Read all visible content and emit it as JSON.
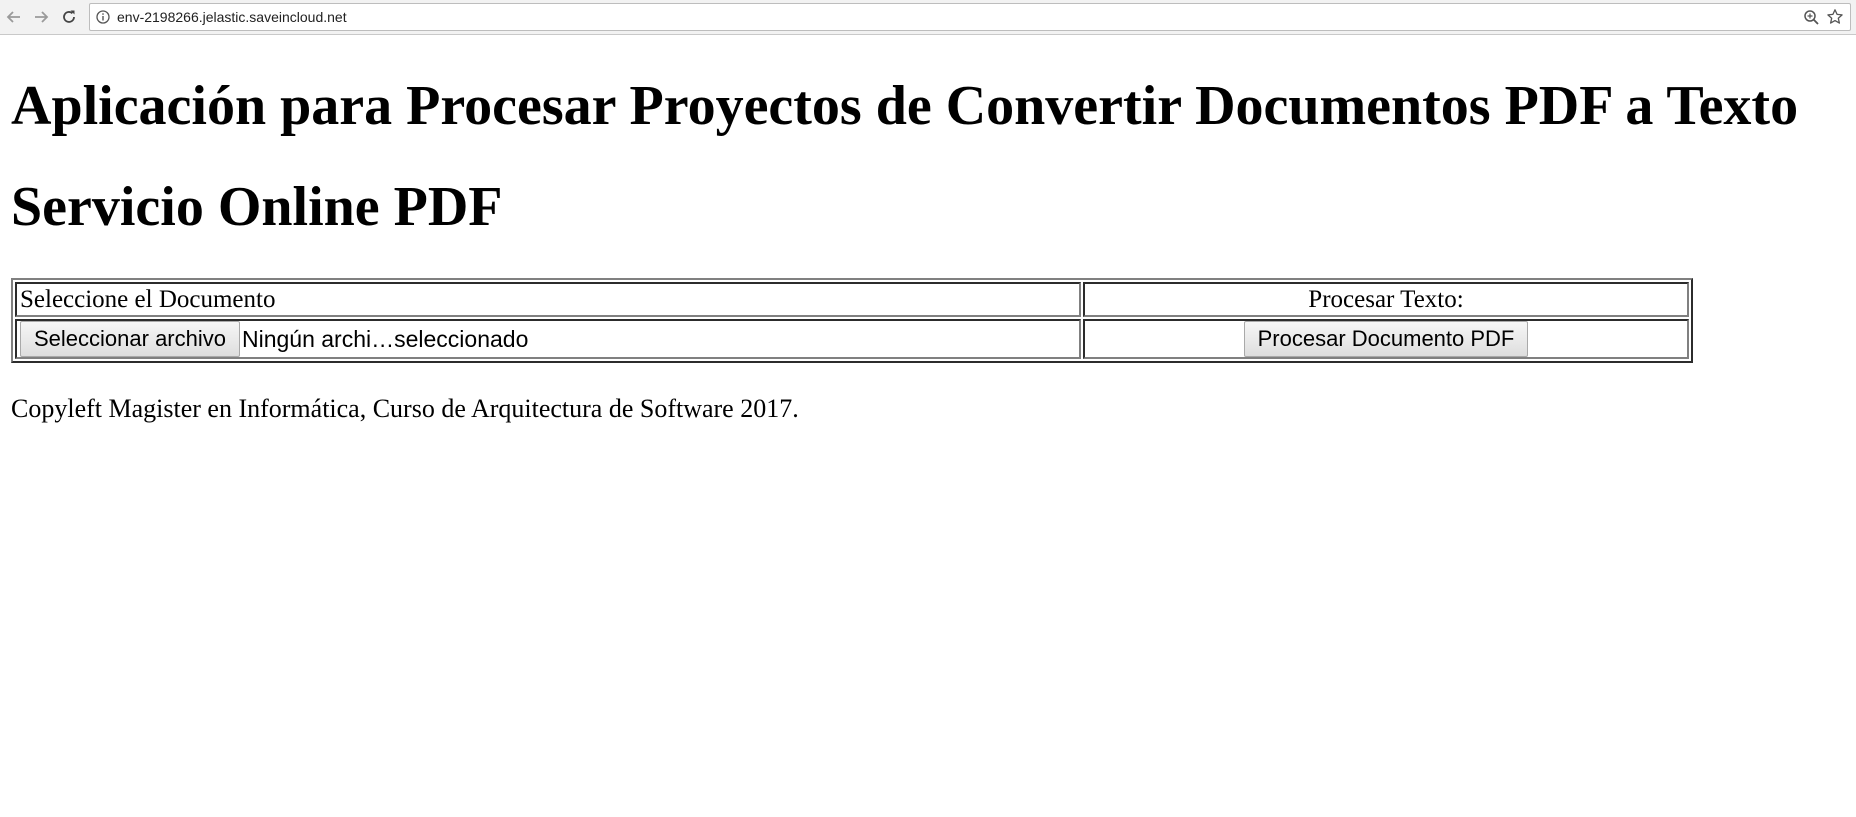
{
  "browser": {
    "url": "env-2198266.jelastic.saveincloud.net"
  },
  "page": {
    "title": "Aplicación para Procesar Proyectos de Convertir Documentos PDF a Texto",
    "subtitle": "Servicio Online PDF",
    "table": {
      "header_left": "Seleccione el Documento",
      "header_right": "Procesar Texto:",
      "file_button_label": "Seleccionar archivo",
      "file_status": "Ningún archi…seleccionado",
      "process_button_label": "Procesar Documento PDF"
    },
    "footer": "Copyleft Magister en Informática, Curso de Arquitectura de Software 2017."
  },
  "icons": {
    "back": "arrow-left-icon",
    "forward": "arrow-right-icon",
    "reload": "reload-icon",
    "info": "info-icon",
    "zoom": "zoom-icon",
    "bookmark": "star-icon"
  }
}
